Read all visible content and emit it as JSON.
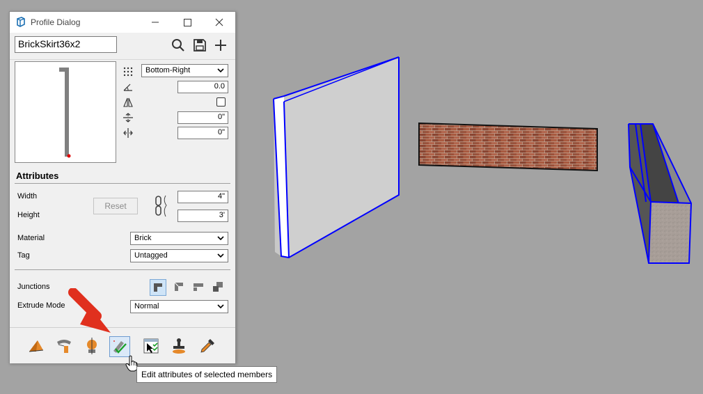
{
  "dialog": {
    "title": "Profile Dialog",
    "window_controls": [
      "minimize",
      "maximize",
      "close"
    ],
    "profile_name": "BrickSkirt36x2",
    "toolbar_icons": [
      "search-icon",
      "save-icon",
      "add-icon"
    ]
  },
  "placement": {
    "anchor": "Bottom-Right",
    "rotation": "0.0",
    "mirror_checked": false,
    "x_offset": "0\"",
    "y_offset": "0\""
  },
  "attributes": {
    "heading": "Attributes",
    "width_label": "Width",
    "width_value": "4\"",
    "height_label": "Height",
    "height_value": "3'",
    "reset_label": "Reset",
    "material_label": "Material",
    "material_value": "Brick",
    "tag_label": "Tag",
    "tag_value": "Untagged",
    "junctions_label": "Junctions",
    "extrude_label": "Extrude Mode",
    "extrude_value": "Normal"
  },
  "bottom_toolbar": [
    "extrude-icon",
    "follow-path-icon",
    "revolve-icon",
    "edit-attributes-icon",
    "select-members-icon",
    "stamp-icon",
    "eyedropper-icon"
  ],
  "tooltip": "Edit attributes of selected members",
  "colors": {
    "viewport_bg": "#a3a3a3",
    "selection_edge": "#0000ff",
    "annotation_arrow": "#e0301e",
    "brick": "#9b4f38"
  }
}
